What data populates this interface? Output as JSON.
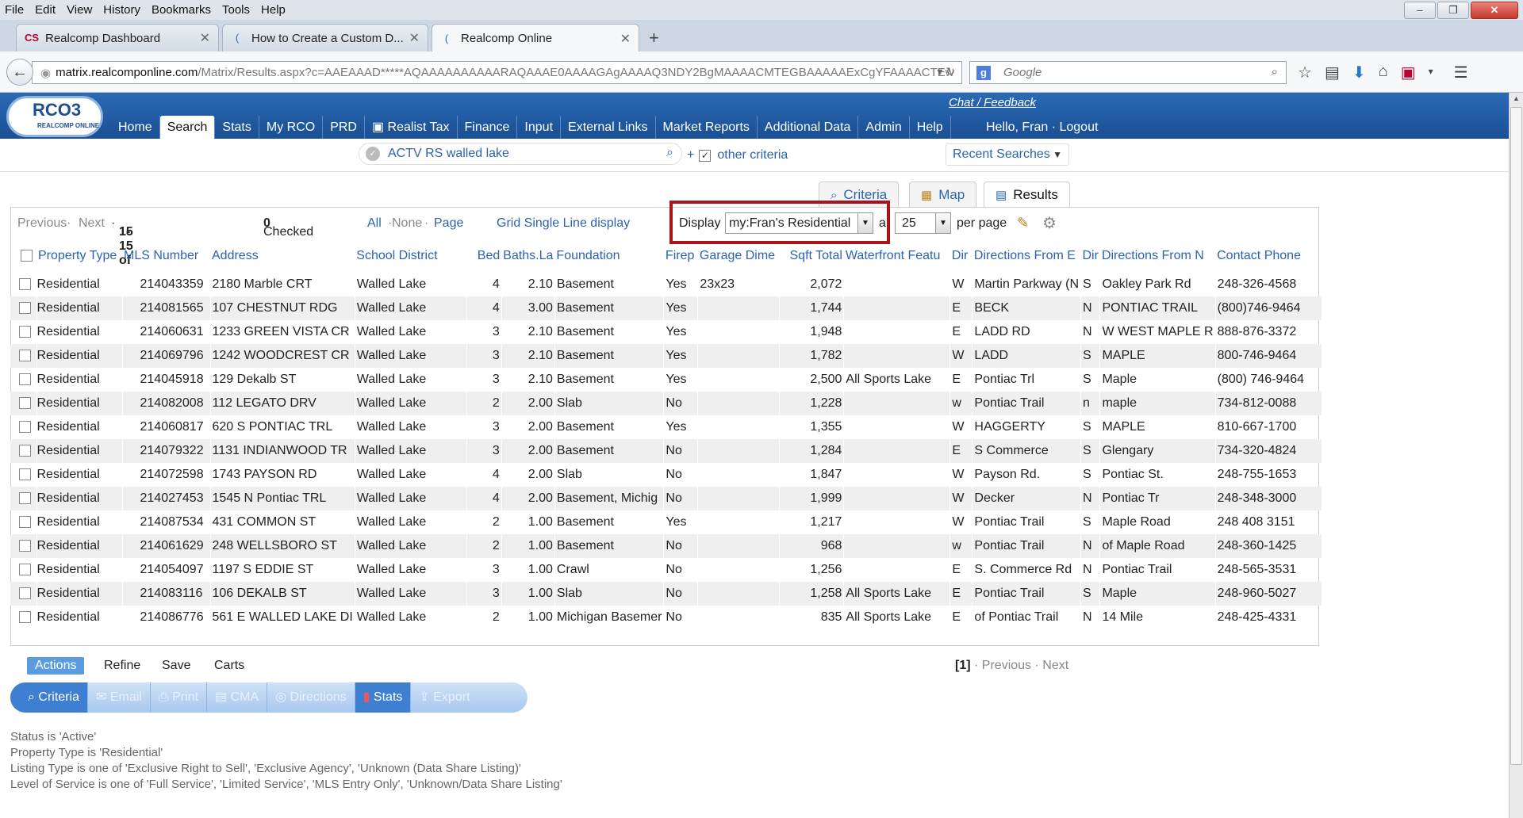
{
  "browser": {
    "menu": [
      "File",
      "Edit",
      "View",
      "History",
      "Bookmarks",
      "Tools",
      "Help"
    ],
    "tabs": [
      {
        "title": "Realcomp Dashboard",
        "icon": "CS"
      },
      {
        "title": "How to Create a Custom D...",
        "icon": "("
      },
      {
        "title": "Realcomp Online",
        "icon": "("
      }
    ],
    "url_host": "matrix.realcomponline.com",
    "url_rest": "/Matrix/Results.aspx?c=AAEAAAD*****AQAAAAAAAAAARAQAAAE0AAAAGAgAAAAQ3NDY2BgMAAAACMTEGBAAAAAExCgYFAAAACTEw",
    "search_placeholder": "Google",
    "search_engine_letter": "g"
  },
  "app": {
    "logo_text": "RCO3",
    "logo_sub": "REALCOMP ONLINE",
    "chat_link": "Chat / Feedback",
    "nav": [
      "Home",
      "Search",
      "Stats",
      "My RCO",
      "PRD",
      "Realist Tax",
      "Finance",
      "Input",
      "External Links",
      "Market Reports",
      "Additional Data",
      "Admin",
      "Help"
    ],
    "nav_selected": "Search",
    "greeting": "Hello, Fran · Logout",
    "criteria_text": "ACTV RS walled lake",
    "plus": "+",
    "other_criteria": "other criteria",
    "recent_searches": "Recent Searches"
  },
  "view_tabs": [
    "Criteria",
    "Map",
    "Results"
  ],
  "results": {
    "prev": "Previous",
    "next": "Next",
    "range_prefix": "1-15 of",
    "total": "15",
    "checked_label": "Checked",
    "checked_count": "0",
    "all": "All",
    "none": "None",
    "page": "Page",
    "grid_mode": "Grid Single Line display",
    "display_label": "Display",
    "display_value": "my:Fran's Residential",
    "at": "a",
    "per_page_value": "25",
    "per_page_label": "per page",
    "columns": [
      "Property Type",
      "MLS Number",
      "Address",
      "School District",
      "Bed",
      "Baths.La",
      "Foundation",
      "Firep",
      "Garage Dime",
      "Sqft Total",
      "Waterfront Featu",
      "Dir",
      "Directions From E",
      "Dir",
      "Directions From N",
      "Contact Phone"
    ],
    "rows": [
      [
        "Residential",
        "214043359",
        "2180 Marble CRT",
        "Walled Lake",
        "4",
        "2.10",
        "Basement",
        "Yes",
        "23x23",
        "2,072",
        "",
        "W",
        "Martin Parkway (N",
        "S",
        "Oakley Park Rd",
        "248-326-4568"
      ],
      [
        "Residential",
        "214081565",
        "107 CHESTNUT RDG",
        "Walled Lake",
        "4",
        "3.00",
        "Basement",
        "Yes",
        "",
        "1,744",
        "",
        "E",
        "BECK",
        "N",
        "PONTIAC TRAIL",
        "(800)746-9464"
      ],
      [
        "Residential",
        "214060631",
        "1233 GREEN VISTA CR",
        "Walled Lake",
        "3",
        "2.10",
        "Basement",
        "Yes",
        "",
        "1,948",
        "",
        "E",
        "LADD RD",
        "N",
        "W WEST MAPLE R",
        "888-876-3372"
      ],
      [
        "Residential",
        "214069796",
        "1242 WOODCREST CR",
        "Walled Lake",
        "3",
        "2.10",
        "Basement",
        "Yes",
        "",
        "1,782",
        "",
        "W",
        "LADD",
        "S",
        "MAPLE",
        "800-746-9464"
      ],
      [
        "Residential",
        "214045918",
        "129 Dekalb ST",
        "Walled Lake",
        "3",
        "2.10",
        "Basement",
        "Yes",
        "",
        "2,500",
        "All Sports Lake",
        "E",
        "Pontiac Trl",
        "S",
        "Maple",
        "(800) 746-9464"
      ],
      [
        "Residential",
        "214082008",
        "112 LEGATO DRV",
        "Walled Lake",
        "2",
        "2.00",
        "Slab",
        "No",
        "",
        "1,228",
        "",
        "w",
        "Pontiac Trail",
        "n",
        "maple",
        "734-812-0088"
      ],
      [
        "Residential",
        "214060817",
        "620 S PONTIAC TRL",
        "Walled Lake",
        "3",
        "2.00",
        "Basement",
        "Yes",
        "",
        "1,355",
        "",
        "W",
        "HAGGERTY",
        "S",
        "MAPLE",
        "810-667-1700"
      ],
      [
        "Residential",
        "214079322",
        "1131 INDIANWOOD TR",
        "Walled Lake",
        "3",
        "2.00",
        "Basement",
        "No",
        "",
        "1,284",
        "",
        "E",
        "S Commerce",
        "S",
        "Glengary",
        "734-320-4824"
      ],
      [
        "Residential",
        "214072598",
        "1743 PAYSON RD",
        "Walled Lake",
        "4",
        "2.00",
        "Slab",
        "No",
        "",
        "1,847",
        "",
        "W",
        "Payson Rd.",
        "S",
        "Pontiac St.",
        "248-755-1653"
      ],
      [
        "Residential",
        "214027453",
        "1545 N Pontiac TRL",
        "Walled Lake",
        "4",
        "2.00",
        "Basement, Michig",
        "No",
        "",
        "1,999",
        "",
        "W",
        "Decker",
        "N",
        "Pontiac Tr",
        "248-348-3000"
      ],
      [
        "Residential",
        "214087534",
        "431 COMMON ST",
        "Walled Lake",
        "2",
        "1.00",
        "Basement",
        "Yes",
        "",
        "1,217",
        "",
        "W",
        "Pontiac Trail",
        "S",
        "Maple Road",
        "248 408 3151"
      ],
      [
        "Residential",
        "214061629",
        "248 WELLSBORO ST",
        "Walled Lake",
        "2",
        "1.00",
        "Basement",
        "No",
        "",
        "968",
        "",
        "w",
        "Pontiac Trail",
        "N",
        "of Maple Road",
        "248-360-1425"
      ],
      [
        "Residential",
        "214054097",
        "1197 S EDDIE ST",
        "Walled Lake",
        "3",
        "1.00",
        "Crawl",
        "No",
        "",
        "1,256",
        "",
        "E",
        "S. Commerce Rd",
        "N",
        "Pontiac Trail",
        "248-565-3531"
      ],
      [
        "Residential",
        "214083116",
        "106 DEKALB ST",
        "Walled Lake",
        "3",
        "1.00",
        "Slab",
        "No",
        "",
        "1,258",
        "All Sports Lake",
        "E",
        "Pontiac Trail",
        "S",
        "Maple",
        "248-960-5027"
      ],
      [
        "Residential",
        "214086776",
        "561 E WALLED LAKE DI",
        "Walled Lake",
        "2",
        "1.00",
        "Michigan Basemer",
        "No",
        "",
        "835",
        "All Sports Lake",
        "E",
        "of Pontiac Trail",
        "N",
        "14 Mile",
        "248-425-4331"
      ]
    ]
  },
  "actions": {
    "tabs": [
      "Actions",
      "Refine",
      "Save",
      "Carts"
    ],
    "buttons": [
      "Criteria",
      "Email",
      "Print",
      "CMA",
      "Directions",
      "Stats",
      "Export"
    ],
    "page_current": "[1]",
    "prev": "Previous",
    "next": "Next"
  },
  "summary": [
    "Status is 'Active'",
    "Property Type is 'Residential'",
    "Listing Type is one of 'Exclusive Right to Sell', 'Exclusive Agency', 'Unknown (Data Share Listing)'",
    "Level of Service is one of 'Full Service', 'Limited Service', 'MLS Entry Only', 'Unknown/Data Share Listing'"
  ],
  "colors": {
    "header_blue": "#1f5aa3",
    "link_blue": "#2b63b0",
    "highlight_red": "#a8141b"
  }
}
